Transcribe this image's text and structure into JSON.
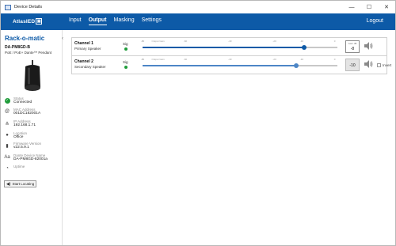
{
  "window": {
    "title": "Device Details",
    "minimize": "—",
    "maximize": "☐",
    "close": "✕"
  },
  "nav": {
    "logo_text": "AtlasIED",
    "logo_led": "LED",
    "logo_mark": "▣",
    "tabs": [
      {
        "label": "Input",
        "active": false
      },
      {
        "label": "Output",
        "active": true
      },
      {
        "label": "Masking",
        "active": false
      },
      {
        "label": "Settings",
        "active": false
      }
    ],
    "logout": "Logout"
  },
  "sidebar": {
    "device_title": "Rack-o-matic",
    "model": "DA-PM8GD-B",
    "model_desc": "PoE / PoE+ Dante™ Pendant",
    "info": [
      {
        "label": "Status",
        "value": "Connected",
        "icon": "status-check-icon"
      },
      {
        "label": "MAC Address",
        "value": "001DC182001A",
        "icon": "at-icon"
      },
      {
        "label": "IP Address",
        "value": "192.168.1.71",
        "icon": "network-icon"
      },
      {
        "label": "Location",
        "value": "Office",
        "icon": "location-icon"
      },
      {
        "label": "Firmware Version",
        "value": "v22.5.9.1",
        "icon": "firmware-icon"
      },
      {
        "label": "Dante Device Name",
        "value": "DA-PM8GD-82001a",
        "icon": "text-aa-icon"
      },
      {
        "label": "Uptime",
        "value": "",
        "icon": "uptime-icon"
      }
    ],
    "locate_button": "Start Locating"
  },
  "channels": [
    {
      "name": "Channel 1",
      "sub": "Primary Speaker",
      "sig_label": "Sig",
      "gain_label": "Gain dB",
      "gain_value": "-8",
      "level": 0.83,
      "disabled": false,
      "show_invert": false
    },
    {
      "name": "Channel 2",
      "sub": "Secondary Speaker",
      "sig_label": "Sig",
      "gain_label": "",
      "gain_value": "-10",
      "level": 0.79,
      "disabled": true,
      "show_invert": true,
      "invert_label": "Invert"
    }
  ],
  "scale_ticks": [
    "-80",
    "Output Gain",
    "-60",
    "-40",
    "-20",
    "-10",
    "0"
  ],
  "colors": {
    "brand": "#0d5aa7",
    "status_ok": "#1f9c3a"
  }
}
